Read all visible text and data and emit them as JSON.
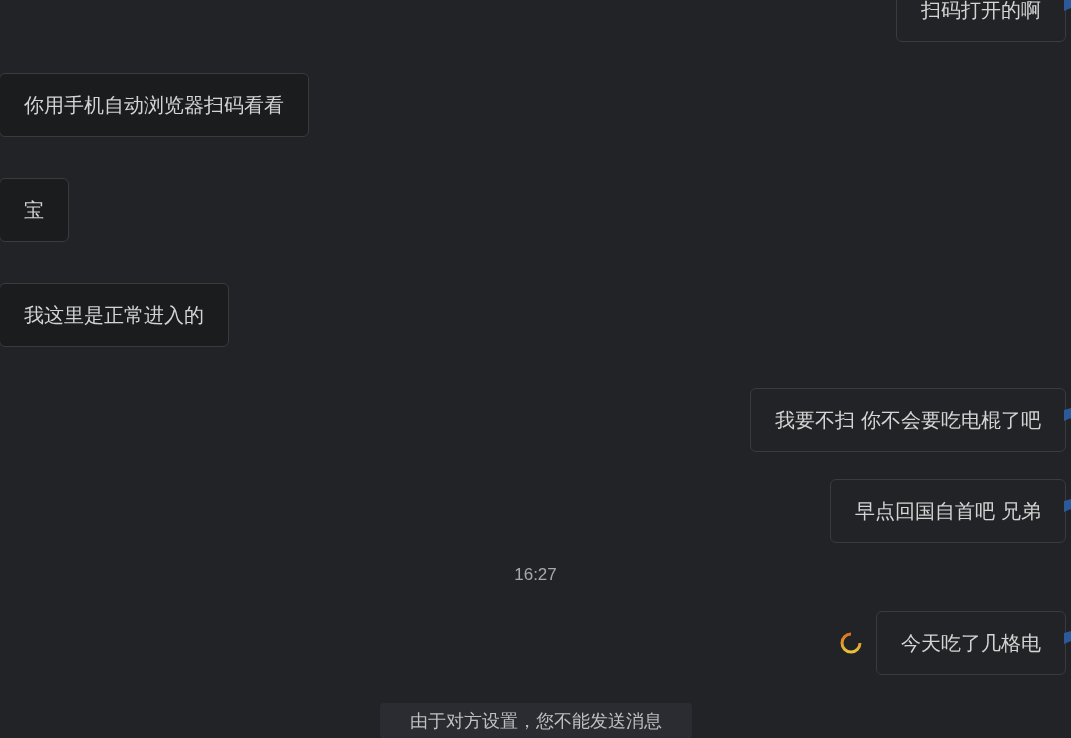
{
  "messages": [
    {
      "kind": "sent",
      "text": "扫码打开的啊",
      "pending": false
    },
    {
      "kind": "received",
      "text": "你用手机自动浏览器扫码看看"
    },
    {
      "kind": "received",
      "text": "宝"
    },
    {
      "kind": "received",
      "text": "我这里是正常进入的"
    },
    {
      "kind": "sent",
      "text": "我要不扫 你不会要吃电棍了吧",
      "pending": false
    },
    {
      "kind": "sent",
      "text": "早点回国自首吧 兄弟",
      "pending": false
    },
    {
      "kind": "time",
      "text": "16:27"
    },
    {
      "kind": "sent",
      "text": "今天吃了几格电",
      "pending": true
    }
  ],
  "notice": "由于对方设置，您不能发送消息"
}
